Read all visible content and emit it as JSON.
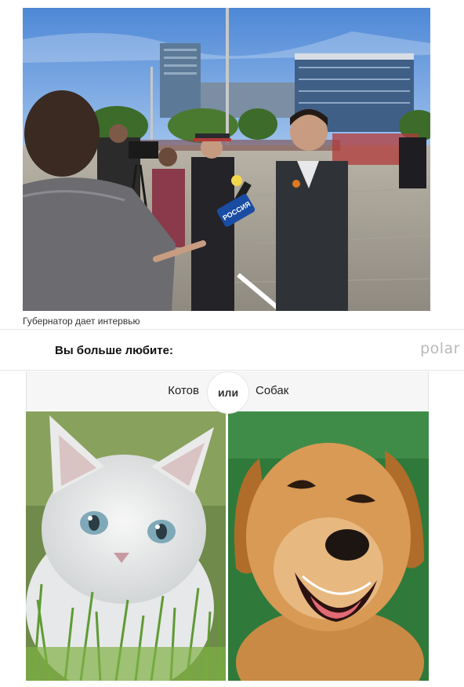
{
  "article": {
    "photo_alt": "",
    "caption": "Губернатор дает интервью"
  },
  "poll": {
    "question": "Вы больше любите:",
    "brand": "polar",
    "option_left": "Котов",
    "separator": "или",
    "option_right": "Собак",
    "microphone_text": "РОССИЯ"
  }
}
